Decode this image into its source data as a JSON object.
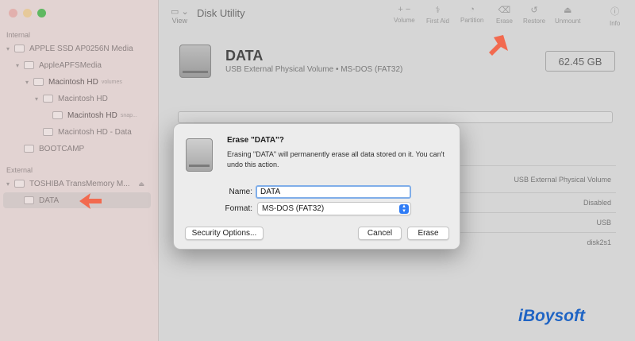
{
  "window": {
    "title": "Disk Utility",
    "view_label": "View"
  },
  "sidebar": {
    "internal_label": "Internal",
    "external_label": "External",
    "items": [
      {
        "label": "APPLE SSD AP0256N Media"
      },
      {
        "label": "AppleAPFSMedia"
      },
      {
        "label": "Macintosh HD",
        "sub": "volumes"
      },
      {
        "label": "Macintosh HD"
      },
      {
        "label": "Macintosh HD",
        "sub": "snap..."
      },
      {
        "label": "Macintosh HD - Data"
      },
      {
        "label": "BOOTCAMP"
      },
      {
        "label": "TOSHIBA TransMemory M..."
      },
      {
        "label": "DATA"
      }
    ]
  },
  "toolbar": {
    "items": [
      {
        "label": "Volume",
        "icon": "+ −"
      },
      {
        "label": "First Aid",
        "icon": "⚕"
      },
      {
        "label": "Partition",
        "icon": "◔"
      },
      {
        "label": "Erase",
        "icon": "⌫"
      },
      {
        "label": "Restore",
        "icon": "↺"
      },
      {
        "label": "Unmount",
        "icon": "⏏"
      },
      {
        "label": "Info",
        "icon": "ⓘ"
      }
    ]
  },
  "volume": {
    "name": "DATA",
    "description": "USB External Physical Volume • MS-DOS (FAT32)",
    "size": "62.45 GB",
    "info_values": [
      "USB External Physical Volume",
      "Disabled",
      "USB",
      "disk2s1"
    ]
  },
  "dialog": {
    "title": "Erase \"DATA\"?",
    "message": "Erasing \"DATA\" will permanently erase all data stored on it. You can't undo this action.",
    "name_label": "Name:",
    "name_value": "DATA",
    "format_label": "Format:",
    "format_value": "MS-DOS (FAT32)",
    "security_button": "Security Options...",
    "cancel_button": "Cancel",
    "erase_button": "Erase"
  },
  "watermark": {
    "text": "iBoysoft"
  },
  "colors": {
    "accent": "#2f7cf6",
    "arrow": "#f26a4f",
    "logo": "#1f64c4"
  }
}
